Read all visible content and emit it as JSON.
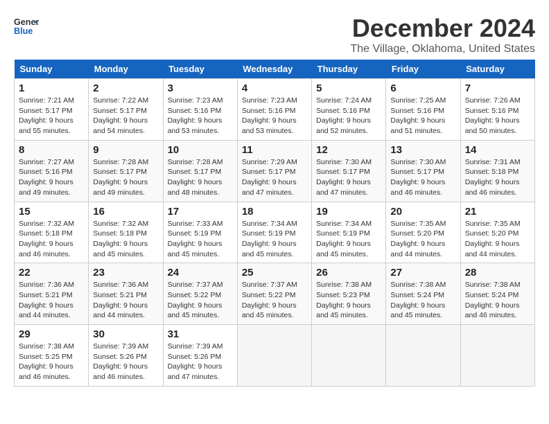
{
  "logo": {
    "line1": "General",
    "line2": "Blue"
  },
  "title": "December 2024",
  "subtitle": "The Village, Oklahoma, United States",
  "days_of_week": [
    "Sunday",
    "Monday",
    "Tuesday",
    "Wednesday",
    "Thursday",
    "Friday",
    "Saturday"
  ],
  "weeks": [
    [
      {
        "day": "1",
        "sunrise": "7:21 AM",
        "sunset": "5:17 PM",
        "daylight": "9 hours and 55 minutes."
      },
      {
        "day": "2",
        "sunrise": "7:22 AM",
        "sunset": "5:17 PM",
        "daylight": "9 hours and 54 minutes."
      },
      {
        "day": "3",
        "sunrise": "7:23 AM",
        "sunset": "5:16 PM",
        "daylight": "9 hours and 53 minutes."
      },
      {
        "day": "4",
        "sunrise": "7:23 AM",
        "sunset": "5:16 PM",
        "daylight": "9 hours and 53 minutes."
      },
      {
        "day": "5",
        "sunrise": "7:24 AM",
        "sunset": "5:16 PM",
        "daylight": "9 hours and 52 minutes."
      },
      {
        "day": "6",
        "sunrise": "7:25 AM",
        "sunset": "5:16 PM",
        "daylight": "9 hours and 51 minutes."
      },
      {
        "day": "7",
        "sunrise": "7:26 AM",
        "sunset": "5:16 PM",
        "daylight": "9 hours and 50 minutes."
      }
    ],
    [
      {
        "day": "8",
        "sunrise": "7:27 AM",
        "sunset": "5:16 PM",
        "daylight": "9 hours and 49 minutes."
      },
      {
        "day": "9",
        "sunrise": "7:28 AM",
        "sunset": "5:17 PM",
        "daylight": "9 hours and 49 minutes."
      },
      {
        "day": "10",
        "sunrise": "7:28 AM",
        "sunset": "5:17 PM",
        "daylight": "9 hours and 48 minutes."
      },
      {
        "day": "11",
        "sunrise": "7:29 AM",
        "sunset": "5:17 PM",
        "daylight": "9 hours and 47 minutes."
      },
      {
        "day": "12",
        "sunrise": "7:30 AM",
        "sunset": "5:17 PM",
        "daylight": "9 hours and 47 minutes."
      },
      {
        "day": "13",
        "sunrise": "7:30 AM",
        "sunset": "5:17 PM",
        "daylight": "9 hours and 46 minutes."
      },
      {
        "day": "14",
        "sunrise": "7:31 AM",
        "sunset": "5:18 PM",
        "daylight": "9 hours and 46 minutes."
      }
    ],
    [
      {
        "day": "15",
        "sunrise": "7:32 AM",
        "sunset": "5:18 PM",
        "daylight": "9 hours and 46 minutes."
      },
      {
        "day": "16",
        "sunrise": "7:32 AM",
        "sunset": "5:18 PM",
        "daylight": "9 hours and 45 minutes."
      },
      {
        "day": "17",
        "sunrise": "7:33 AM",
        "sunset": "5:19 PM",
        "daylight": "9 hours and 45 minutes."
      },
      {
        "day": "18",
        "sunrise": "7:34 AM",
        "sunset": "5:19 PM",
        "daylight": "9 hours and 45 minutes."
      },
      {
        "day": "19",
        "sunrise": "7:34 AM",
        "sunset": "5:19 PM",
        "daylight": "9 hours and 45 minutes."
      },
      {
        "day": "20",
        "sunrise": "7:35 AM",
        "sunset": "5:20 PM",
        "daylight": "9 hours and 44 minutes."
      },
      {
        "day": "21",
        "sunrise": "7:35 AM",
        "sunset": "5:20 PM",
        "daylight": "9 hours and 44 minutes."
      }
    ],
    [
      {
        "day": "22",
        "sunrise": "7:36 AM",
        "sunset": "5:21 PM",
        "daylight": "9 hours and 44 minutes."
      },
      {
        "day": "23",
        "sunrise": "7:36 AM",
        "sunset": "5:21 PM",
        "daylight": "9 hours and 44 minutes."
      },
      {
        "day": "24",
        "sunrise": "7:37 AM",
        "sunset": "5:22 PM",
        "daylight": "9 hours and 45 minutes."
      },
      {
        "day": "25",
        "sunrise": "7:37 AM",
        "sunset": "5:22 PM",
        "daylight": "9 hours and 45 minutes."
      },
      {
        "day": "26",
        "sunrise": "7:38 AM",
        "sunset": "5:23 PM",
        "daylight": "9 hours and 45 minutes."
      },
      {
        "day": "27",
        "sunrise": "7:38 AM",
        "sunset": "5:24 PM",
        "daylight": "9 hours and 45 minutes."
      },
      {
        "day": "28",
        "sunrise": "7:38 AM",
        "sunset": "5:24 PM",
        "daylight": "9 hours and 46 minutes."
      }
    ],
    [
      {
        "day": "29",
        "sunrise": "7:38 AM",
        "sunset": "5:25 PM",
        "daylight": "9 hours and 46 minutes."
      },
      {
        "day": "30",
        "sunrise": "7:39 AM",
        "sunset": "5:26 PM",
        "daylight": "9 hours and 46 minutes."
      },
      {
        "day": "31",
        "sunrise": "7:39 AM",
        "sunset": "5:26 PM",
        "daylight": "9 hours and 47 minutes."
      },
      null,
      null,
      null,
      null
    ]
  ],
  "labels": {
    "sunrise": "Sunrise:",
    "sunset": "Sunset:",
    "daylight": "Daylight:"
  }
}
